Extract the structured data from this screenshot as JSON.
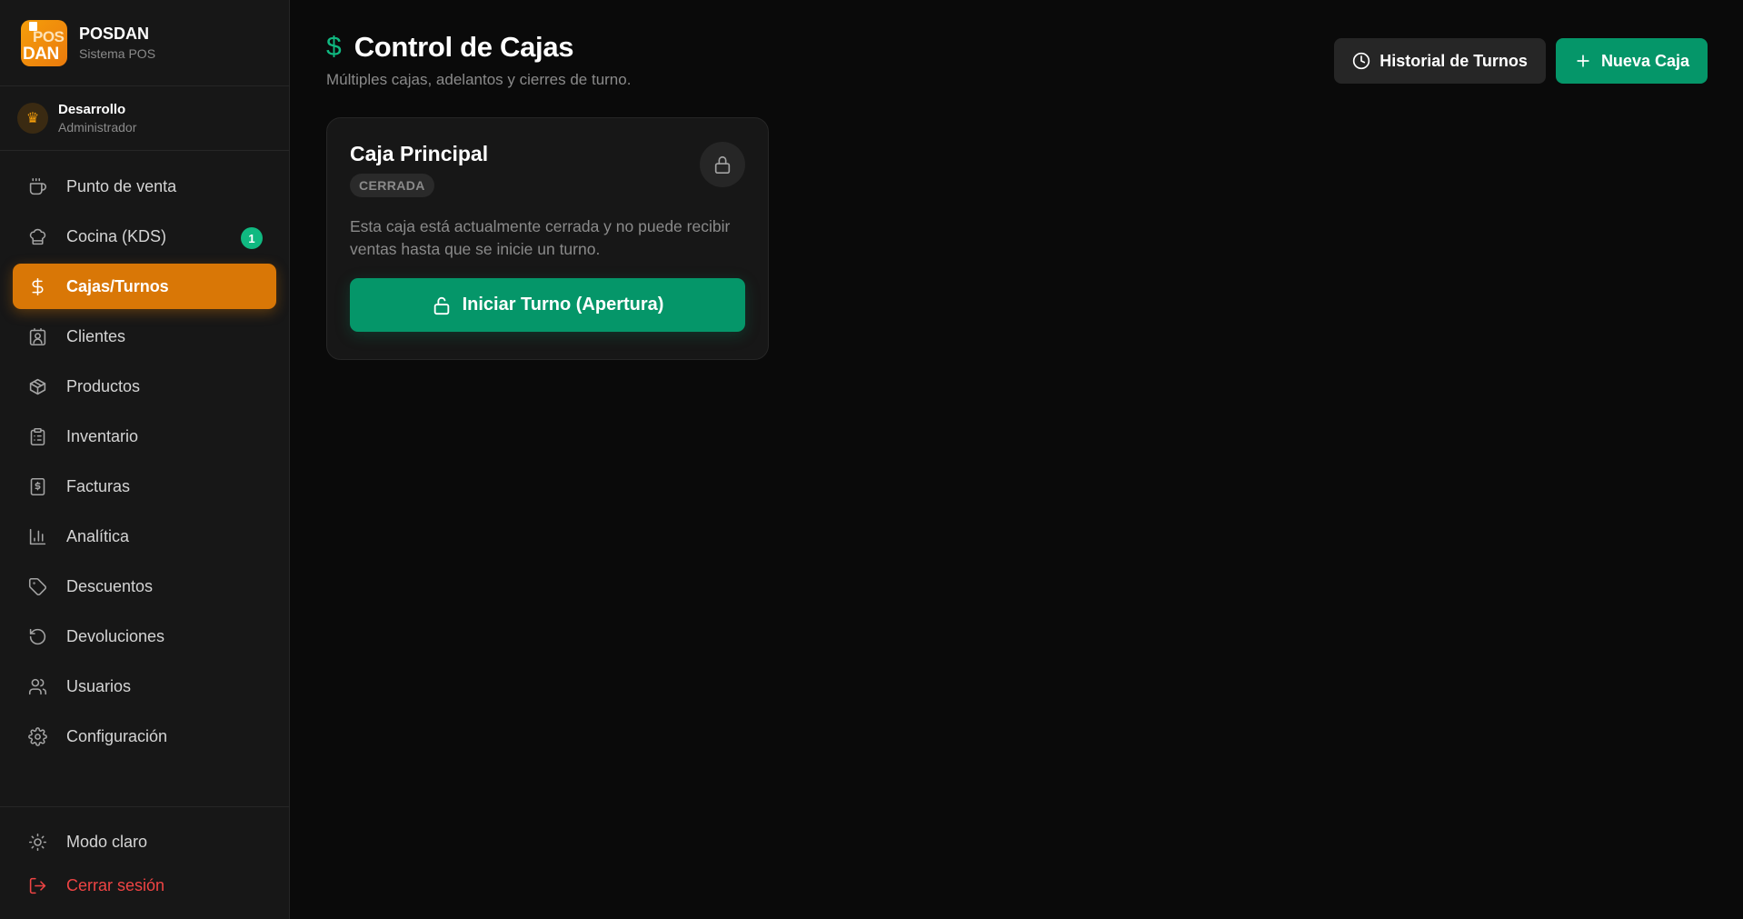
{
  "brand": {
    "name": "POSDAN",
    "subtitle": "Sistema POS",
    "logo_top": "POS",
    "logo_bottom": "DAN"
  },
  "user": {
    "name": "Desarrollo",
    "role": "Administrador",
    "avatar_icon": "crown-icon"
  },
  "nav": [
    {
      "label": "Punto de venta",
      "icon": "coffee-icon"
    },
    {
      "label": "Cocina (KDS)",
      "icon": "chef-hat-icon",
      "badge": "1"
    },
    {
      "label": "Cajas/Turnos",
      "icon": "dollar-icon",
      "active": true
    },
    {
      "label": "Clientes",
      "icon": "contact-icon"
    },
    {
      "label": "Productos",
      "icon": "package-icon"
    },
    {
      "label": "Inventario",
      "icon": "clipboard-list-icon"
    },
    {
      "label": "Facturas",
      "icon": "receipt-icon"
    },
    {
      "label": "Analítica",
      "icon": "bar-chart-icon"
    },
    {
      "label": "Descuentos",
      "icon": "tag-icon"
    },
    {
      "label": "Devoluciones",
      "icon": "rotate-ccw-icon"
    },
    {
      "label": "Usuarios",
      "icon": "users-icon"
    },
    {
      "label": "Configuración",
      "icon": "settings-icon"
    }
  ],
  "bottom": {
    "theme_toggle": "Modo claro",
    "logout": "Cerrar sesión"
  },
  "header": {
    "icon": "$",
    "title": "Control de Cajas",
    "subtitle": "Múltiples cajas, adelantos y cierres de turno."
  },
  "actions": {
    "history": "Historial de Turnos",
    "new_register": "Nueva Caja"
  },
  "register_card": {
    "title": "Caja Principal",
    "status": "CERRADA",
    "description": "Esta caja está actualmente cerrada y no puede recibir ventas hasta que se inicie un turno.",
    "open_button": "Iniciar Turno (Apertura)"
  },
  "colors": {
    "accent": "#d97706",
    "success": "#059669",
    "danger": "#ef4444",
    "background": "#0a0a0a",
    "sidebar": "#171717"
  }
}
